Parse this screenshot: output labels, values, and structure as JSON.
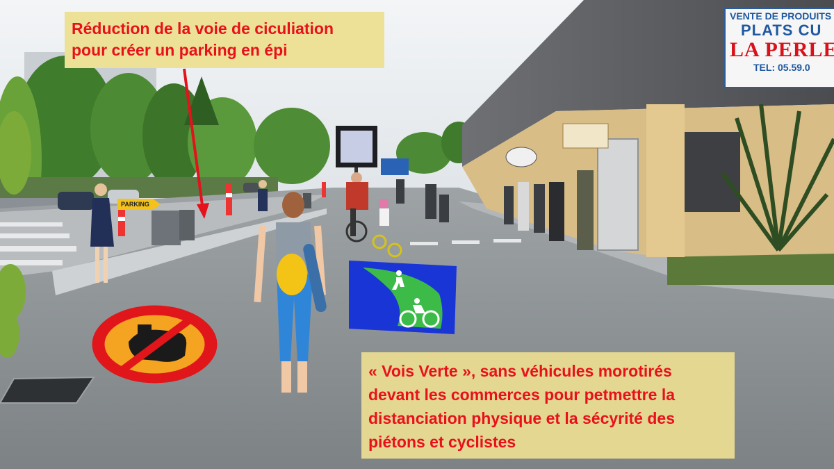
{
  "annotations": {
    "top": {
      "lines": [
        "Réduction de la voie de ciculiation",
        "pour créer un  parking en épi"
      ]
    },
    "bottom": {
      "lines": [
        "« Vois Verte », sans véhicules morotirés",
        "devant les commerces pour petmettre la",
        "distanciation physique et la sécyrité des",
        "piétons et cyclistes"
      ]
    }
  },
  "store_sign": {
    "lines": [
      "VENTE DE PRODUITS",
      "PLATS CU",
      "LA PERLE",
      "TEL: 05.59.0"
    ]
  },
  "parking_sign": {
    "label": "PARKING"
  },
  "colors": {
    "annotation_bg": "#ece196",
    "annotation_text": "#e8111b",
    "arrow": "#e3121b",
    "voie_verte_blue": "#1a35d6",
    "voie_verte_green": "#3dbb48",
    "no_motor_red": "#e0161b",
    "no_motor_orange": "#f5a422"
  },
  "icons": {
    "arrow": "down-arrow-icon",
    "no_motor": "no-motor-vehicles-icon",
    "voie_verte": "pedestrian-cycle-path-icon"
  }
}
